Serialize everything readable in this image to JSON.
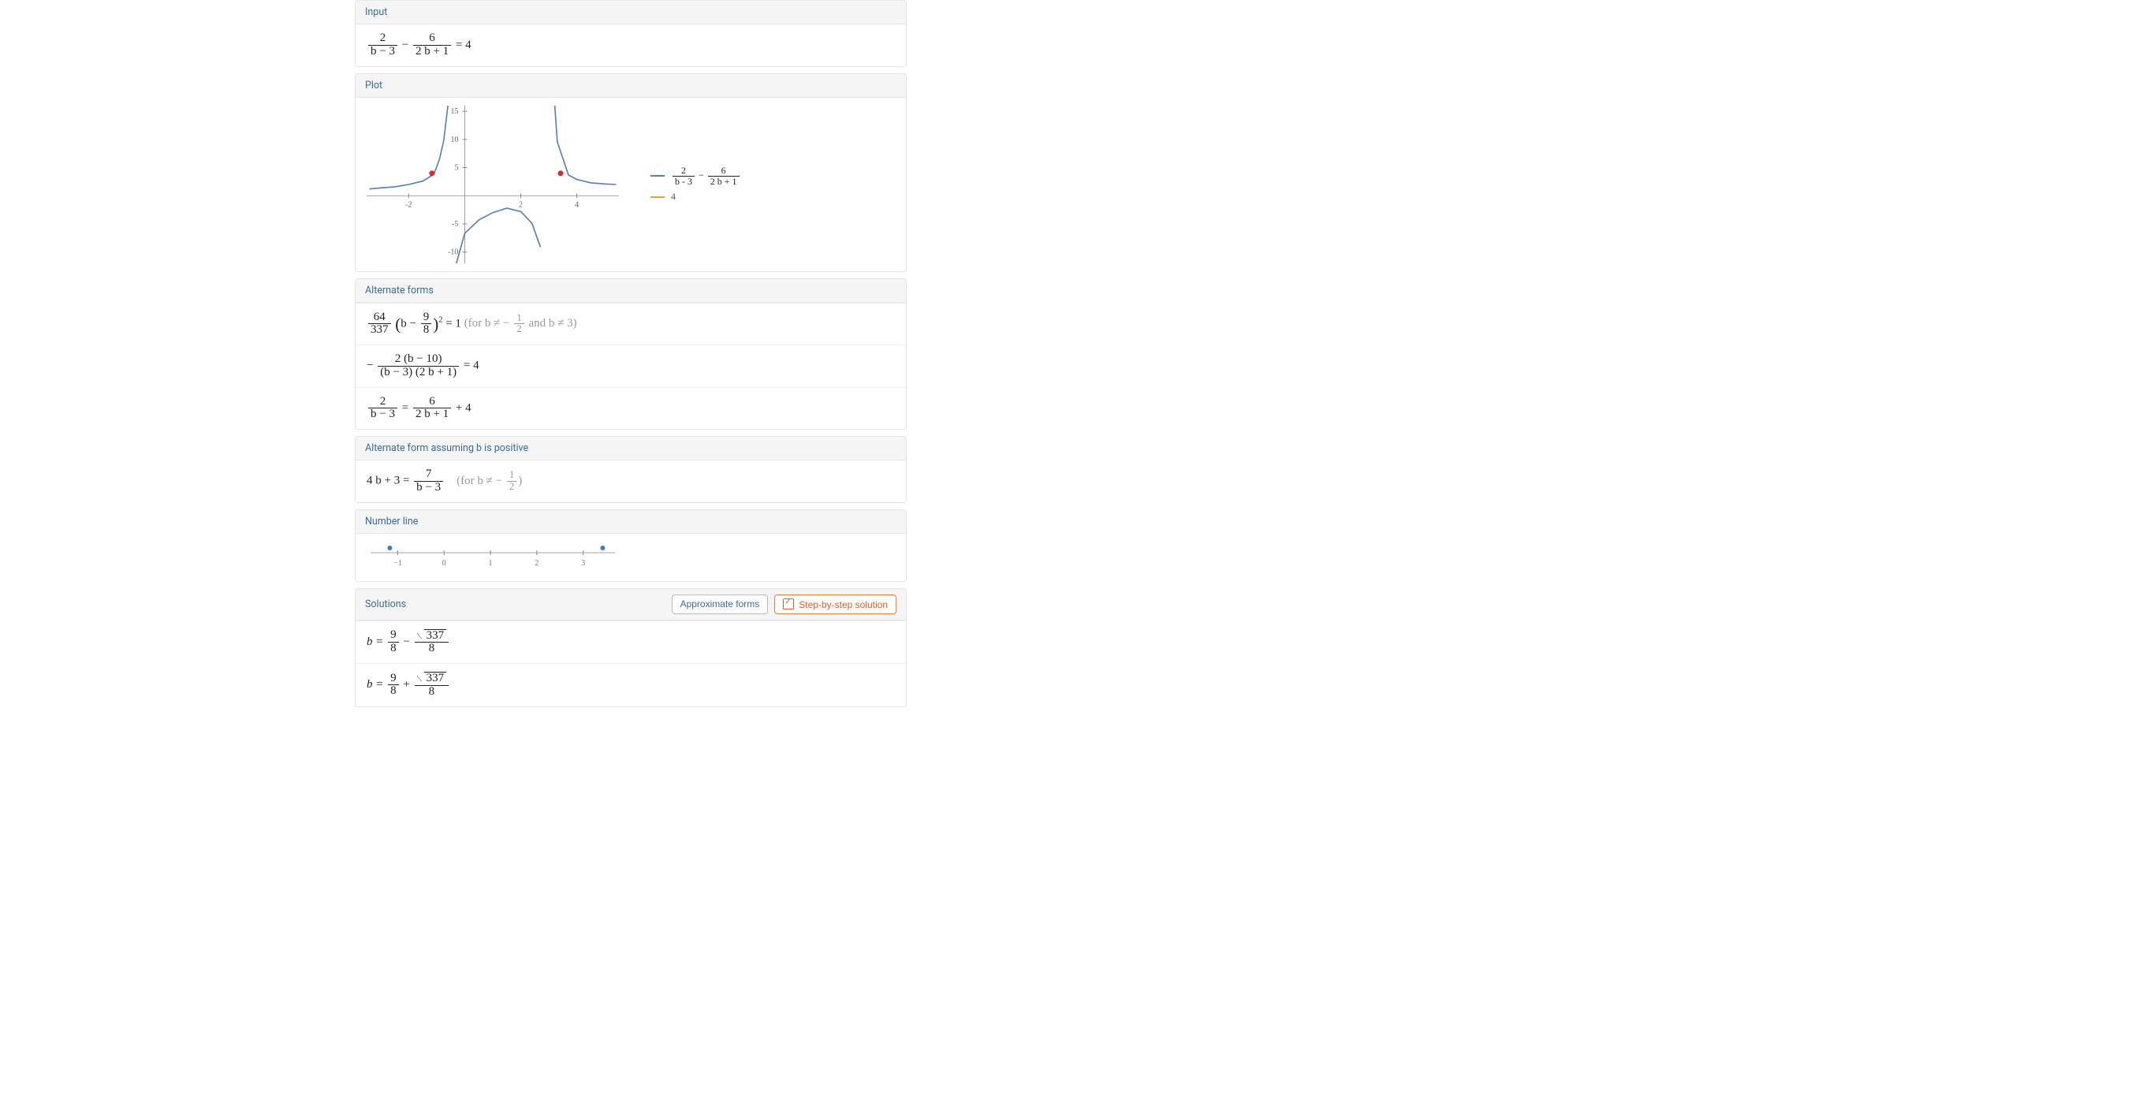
{
  "input": {
    "header": "Input",
    "eq_rhs": "= 4",
    "minus": " − ",
    "f1_top": "2",
    "f1_bot": "b − 3",
    "f2_top": "6",
    "f2_bot": "2 b + 1"
  },
  "plot": {
    "header": "Plot",
    "legend_line2": "4",
    "legend_f1_top": "2",
    "legend_f1_bot": "b - 3",
    "legend_f2_top": "6",
    "legend_f2_bot": "2 b + 1"
  },
  "chart_data": {
    "type": "line",
    "title": "",
    "xlabel": "",
    "ylabel": "",
    "xlim": [
      -3.5,
      5.5
    ],
    "ylim": [
      -12,
      16
    ],
    "xticks": [
      -2,
      2,
      4
    ],
    "yticks": [
      -10,
      -5,
      5,
      10,
      15
    ],
    "vertical_asymptotes": [
      -0.5,
      3
    ],
    "series": [
      {
        "name": "2/(b-3) - 6/(2b+1)",
        "color": "#557bbf",
        "x": [
          -3.4,
          -3,
          -2.5,
          -2,
          -1.5,
          -1.1,
          -0.9,
          -0.75,
          -0.6,
          -0.55,
          -0.45,
          -0.3,
          0,
          0.5,
          1,
          1.5,
          2,
          2.4,
          2.7,
          2.9,
          3.1,
          3.3,
          3.7,
          4,
          4.5,
          5,
          5.4
        ],
        "y": [
          1.2,
          1.4,
          1.6,
          2.0,
          2.6,
          3.8,
          6.5,
          9.8,
          16,
          28,
          -28,
          -12,
          -6.7,
          -4.3,
          -3.0,
          -2.2,
          -2.8,
          -4.9,
          -9.1,
          -24,
          24,
          9.6,
          3.7,
          2.9,
          2.3,
          2.1,
          2.0
        ]
      },
      {
        "name": "4",
        "color": "#e9a23c",
        "x": [
          -3.5,
          5.5
        ],
        "y": [
          4,
          4
        ]
      }
    ],
    "intersection_points": [
      {
        "x": -1.17,
        "y": 4
      },
      {
        "x": 3.42,
        "y": 4
      }
    ]
  },
  "alt_forms": {
    "header": "Alternate forms",
    "row1_a_top": "64",
    "row1_a_bot": "337",
    "row1_b_left": "b − ",
    "row1_b_top": "9",
    "row1_b_bot": "8",
    "row1_sq": "2",
    "row1_eq": " = 1 ",
    "row1_cond_pre": "(for b ≠ − ",
    "row1_cond_top": "1",
    "row1_cond_bot": "2",
    "row1_cond_post": " and b ≠ 3)",
    "row2_minus": "− ",
    "row2_top": "2 (b − 10)",
    "row2_bot": "(b − 3) (2 b + 1)",
    "row2_eq": " = 4",
    "row3_f1t": "2",
    "row3_f1b": "b − 3",
    "row3_mid": " = ",
    "row3_f2t": "6",
    "row3_f2b": "2 b + 1",
    "row3_tail": " + 4"
  },
  "alt_pos": {
    "header": "Alternate form assuming b is positive",
    "lhs": "4 b + 3 = ",
    "frac_top": "7",
    "frac_bot": "b − 3",
    "cond_pre": "(for b ≠ − ",
    "cond_top": "1",
    "cond_bot": "2",
    "cond_post": ")"
  },
  "numberline": {
    "header": "Number line",
    "ticks": [
      "−1",
      "0",
      "1",
      "2",
      "3"
    ],
    "points_x": [
      -1.17,
      3.42
    ],
    "range": [
      -1.5,
      3.6
    ]
  },
  "solutions": {
    "header": "Solutions",
    "btn1": "Approximate forms",
    "btn2": "Step-by-step solution",
    "lead": "b = ",
    "frac_a_top": "9",
    "frac_a_bot": "8",
    "minus": " − ",
    "plus": " + ",
    "sqrt_val": "337",
    "frac_b_bot": "8"
  }
}
